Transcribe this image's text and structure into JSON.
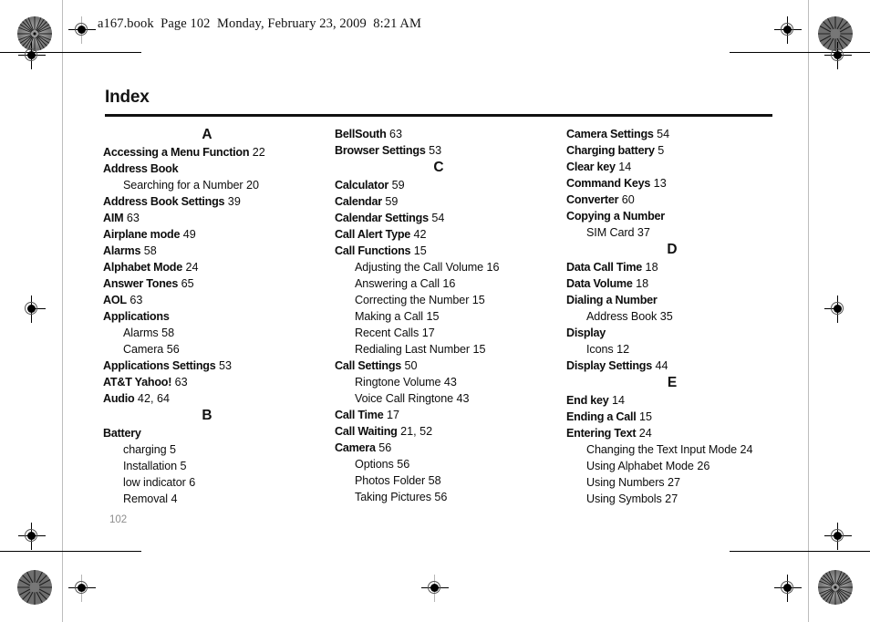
{
  "document": {
    "book_header": "a167.book  Page 102  Monday, February 23, 2009  8:21 AM",
    "title": "Index",
    "folio": "102"
  },
  "columns": [
    {
      "id": "column-1",
      "blocks": [
        {
          "type": "letter",
          "label": "A"
        },
        {
          "type": "entry",
          "level": 0,
          "term": "Accessing a Menu Function",
          "page": "22"
        },
        {
          "type": "entry",
          "level": 0,
          "term": "Address Book",
          "page": ""
        },
        {
          "type": "entry",
          "level": 1,
          "term": "Searching for a Number",
          "page": "20"
        },
        {
          "type": "entry",
          "level": 0,
          "term": "Address Book Settings",
          "page": "39"
        },
        {
          "type": "entry",
          "level": 0,
          "term": "AIM",
          "page": "63"
        },
        {
          "type": "entry",
          "level": 0,
          "term": "Airplane mode",
          "page": "49"
        },
        {
          "type": "entry",
          "level": 0,
          "term": "Alarms",
          "page": "58"
        },
        {
          "type": "entry",
          "level": 0,
          "term": "Alphabet Mode",
          "page": "24"
        },
        {
          "type": "entry",
          "level": 0,
          "term": "Answer Tones",
          "page": "65"
        },
        {
          "type": "entry",
          "level": 0,
          "term": "AOL",
          "page": "63"
        },
        {
          "type": "entry",
          "level": 0,
          "term": "Applications",
          "page": ""
        },
        {
          "type": "entry",
          "level": 1,
          "term": "Alarms",
          "page": "58"
        },
        {
          "type": "entry",
          "level": 1,
          "term": "Camera",
          "page": "56"
        },
        {
          "type": "entry",
          "level": 0,
          "term": "Applications Settings",
          "page": "53"
        },
        {
          "type": "entry",
          "level": 0,
          "term": "AT&T Yahoo!",
          "page": "63"
        },
        {
          "type": "entry",
          "level": 0,
          "term": "Audio",
          "page": "42, 64"
        },
        {
          "type": "letter",
          "label": "B"
        },
        {
          "type": "entry",
          "level": 0,
          "term": "Battery",
          "page": ""
        },
        {
          "type": "entry",
          "level": 1,
          "term": "charging",
          "page": "5"
        },
        {
          "type": "entry",
          "level": 1,
          "term": "Installation",
          "page": "5"
        },
        {
          "type": "entry",
          "level": 1,
          "term": "low indicator",
          "page": "6"
        },
        {
          "type": "entry",
          "level": 1,
          "term": "Removal",
          "page": "4"
        }
      ]
    },
    {
      "id": "column-2",
      "blocks": [
        {
          "type": "entry",
          "level": 0,
          "term": "BellSouth",
          "page": "63"
        },
        {
          "type": "entry",
          "level": 0,
          "term": "Browser Settings",
          "page": "53"
        },
        {
          "type": "letter",
          "label": "C"
        },
        {
          "type": "entry",
          "level": 0,
          "term": "Calculator",
          "page": "59"
        },
        {
          "type": "entry",
          "level": 0,
          "term": "Calendar",
          "page": "59"
        },
        {
          "type": "entry",
          "level": 0,
          "term": "Calendar Settings",
          "page": "54"
        },
        {
          "type": "entry",
          "level": 0,
          "term": "Call Alert Type",
          "page": "42"
        },
        {
          "type": "entry",
          "level": 0,
          "term": "Call Functions",
          "page": "15"
        },
        {
          "type": "entry",
          "level": 1,
          "term": "Adjusting the Call Volume",
          "page": "16"
        },
        {
          "type": "entry",
          "level": 1,
          "term": "Answering a Call",
          "page": "16"
        },
        {
          "type": "entry",
          "level": 1,
          "term": "Correcting the Number",
          "page": "15"
        },
        {
          "type": "entry",
          "level": 1,
          "term": "Making a Call",
          "page": "15"
        },
        {
          "type": "entry",
          "level": 1,
          "term": "Recent Calls",
          "page": "17"
        },
        {
          "type": "entry",
          "level": 1,
          "term": "Redialing Last Number",
          "page": "15"
        },
        {
          "type": "entry",
          "level": 0,
          "term": "Call Settings",
          "page": "50"
        },
        {
          "type": "entry",
          "level": 1,
          "term": "Ringtone Volume",
          "page": "43"
        },
        {
          "type": "entry",
          "level": 1,
          "term": "Voice Call Ringtone",
          "page": "43"
        },
        {
          "type": "entry",
          "level": 0,
          "term": "Call Time",
          "page": "17"
        },
        {
          "type": "entry",
          "level": 0,
          "term": "Call Waiting",
          "page": "21, 52"
        },
        {
          "type": "entry",
          "level": 0,
          "term": "Camera",
          "page": "56"
        },
        {
          "type": "entry",
          "level": 1,
          "term": "Options",
          "page": "56"
        },
        {
          "type": "entry",
          "level": 1,
          "term": "Photos Folder",
          "page": "58"
        },
        {
          "type": "entry",
          "level": 1,
          "term": "Taking Pictures",
          "page": "56"
        }
      ]
    },
    {
      "id": "column-3",
      "blocks": [
        {
          "type": "entry",
          "level": 0,
          "term": "Camera Settings",
          "page": "54"
        },
        {
          "type": "entry",
          "level": 0,
          "term": "Charging battery",
          "page": "5"
        },
        {
          "type": "entry",
          "level": 0,
          "term": "Clear key",
          "page": "14"
        },
        {
          "type": "entry",
          "level": 0,
          "term": "Command Keys",
          "page": "13"
        },
        {
          "type": "entry",
          "level": 0,
          "term": "Converter",
          "page": "60"
        },
        {
          "type": "entry",
          "level": 0,
          "term": "Copying a Number",
          "page": ""
        },
        {
          "type": "entry",
          "level": 1,
          "term": "SIM Card",
          "page": "37"
        },
        {
          "type": "letter",
          "label": "D"
        },
        {
          "type": "entry",
          "level": 0,
          "term": "Data Call Time",
          "page": "18"
        },
        {
          "type": "entry",
          "level": 0,
          "term": "Data Volume",
          "page": "18"
        },
        {
          "type": "entry",
          "level": 0,
          "term": "Dialing a Number",
          "page": ""
        },
        {
          "type": "entry",
          "level": 1,
          "term": "Address Book",
          "page": "35"
        },
        {
          "type": "entry",
          "level": 0,
          "term": "Display",
          "page": ""
        },
        {
          "type": "entry",
          "level": 1,
          "term": "Icons",
          "page": "12"
        },
        {
          "type": "entry",
          "level": 0,
          "term": "Display Settings",
          "page": "44"
        },
        {
          "type": "letter",
          "label": "E"
        },
        {
          "type": "entry",
          "level": 0,
          "term": "End key",
          "page": "14"
        },
        {
          "type": "entry",
          "level": 0,
          "term": "Ending a Call",
          "page": "15"
        },
        {
          "type": "entry",
          "level": 0,
          "term": "Entering Text",
          "page": "24"
        },
        {
          "type": "entry",
          "level": 1,
          "term": "Changing the Text Input Mode",
          "page": "24"
        },
        {
          "type": "entry",
          "level": 1,
          "term": "Using Alphabet Mode",
          "page": "26"
        },
        {
          "type": "entry",
          "level": 1,
          "term": "Using Numbers",
          "page": "27"
        },
        {
          "type": "entry",
          "level": 1,
          "term": "Using Symbols",
          "page": "27"
        }
      ]
    }
  ],
  "print_marks": {
    "registration_label": "registration-target",
    "rosette_label": "color-rosette-target",
    "trim_label": "trim-line"
  }
}
